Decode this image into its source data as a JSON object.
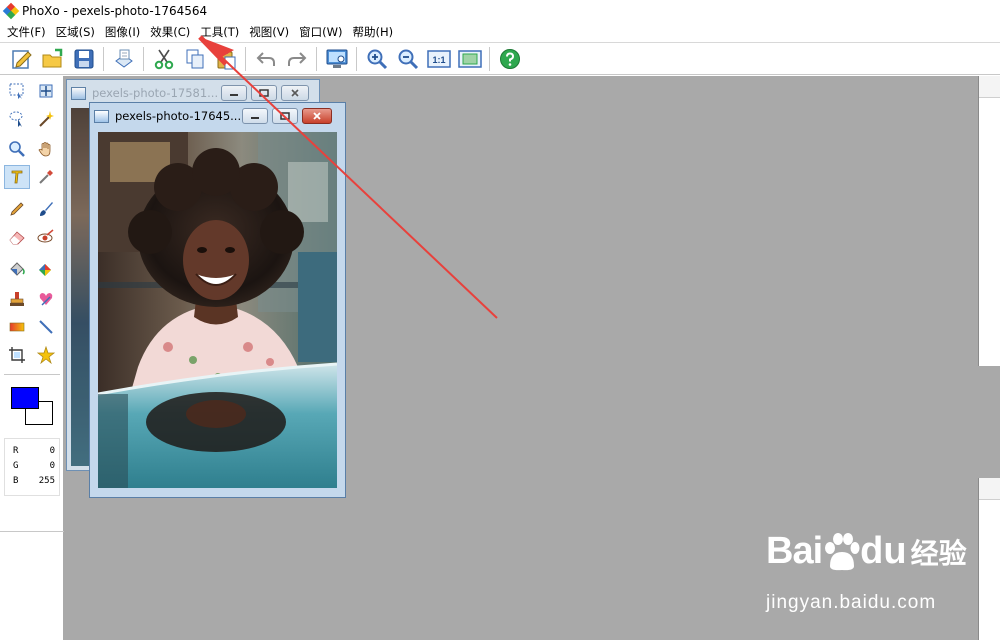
{
  "app": {
    "title": "PhoXo - pexels-photo-1764564"
  },
  "menu": {
    "items": [
      "文件(F)",
      "区域(S)",
      "图像(I)",
      "效果(C)",
      "工具(T)",
      "视图(V)",
      "窗口(W)",
      "帮助(H)"
    ]
  },
  "toolbar": {
    "buttons": [
      "new-icon",
      "open-icon",
      "save-icon",
      "scan-icon",
      "cut-icon",
      "copy-icon",
      "paste-icon",
      "undo-icon",
      "redo-icon",
      "screen-capture-icon",
      "zoom-in-icon",
      "zoom-out-icon",
      "actual-size-icon",
      "fit-window-icon",
      "help-icon"
    ],
    "actual_size_label": "1:1"
  },
  "tools": {
    "active": "text-tool",
    "items": [
      "rect-select-tool",
      "move-tool",
      "lasso-select-tool",
      "magic-wand-tool",
      "zoom-tool",
      "hand-tool",
      "text-tool",
      "eyedropper-tool",
      "pencil-tool",
      "brush-tool",
      "eraser-tool",
      "red-eye-tool",
      "fill-tool",
      "color-replace-tool",
      "clone-stamp-tool",
      "heal-tool",
      "gradient-tool",
      "line-tool",
      "crop-tool",
      "shape-tool"
    ]
  },
  "colors": {
    "primary": "#0000ff",
    "secondary": "#ffffff",
    "accent_arrow": "#e8413c"
  },
  "rgb_readout": {
    "r_label": "R",
    "r_value": "0",
    "g_label": "G",
    "g_value": "0",
    "b_label": "B",
    "b_value": "255"
  },
  "windows": {
    "back_title": "pexels-photo-17581...",
    "front_title": "pexels-photo-17645..."
  },
  "watermark": {
    "logo_text_1": "Bai",
    "logo_text_2": "du",
    "logo_text_cn": "经验",
    "url": "jingyan.baidu.com"
  }
}
